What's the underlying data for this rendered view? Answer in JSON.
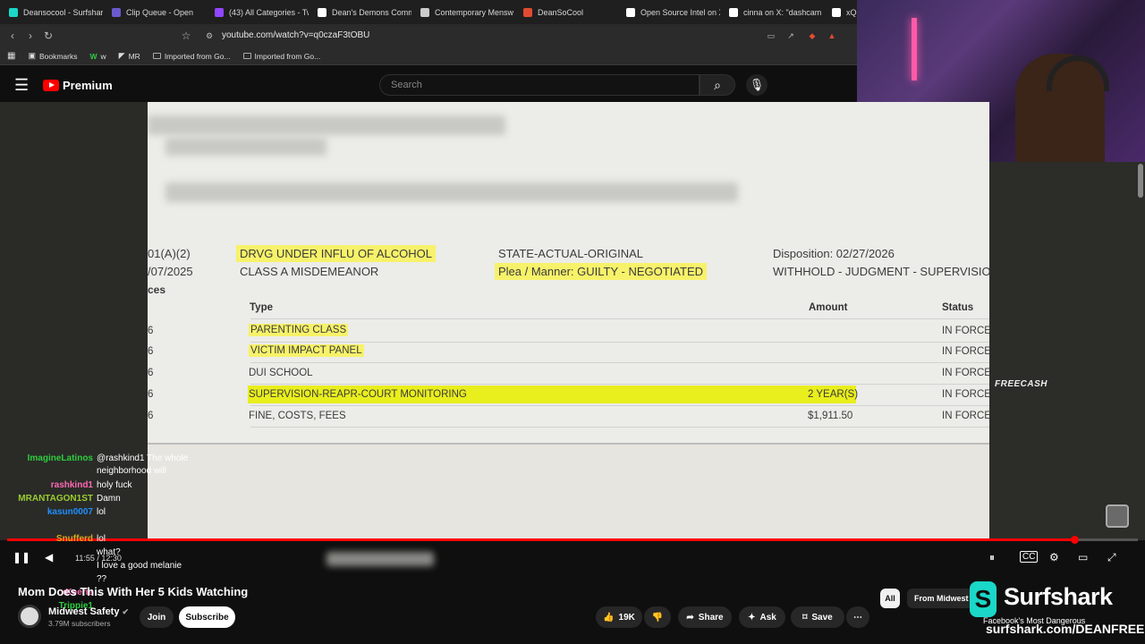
{
  "browser": {
    "tabs": [
      {
        "label": "Deansocool - Surfshark",
        "color": "#1ad7c7"
      },
      {
        "label": "Clip Queue - Open",
        "color": "#6a5acd"
      },
      {
        "label": "(43) All Categories - Tw",
        "color": "#9146ff"
      },
      {
        "label": "Dean's Demons Comm",
        "color": "#ffffff"
      },
      {
        "label": "Contemporary Mensw",
        "color": "#cccccc"
      },
      {
        "label": "DeanSoCool",
        "color": "#e14b32"
      },
      {
        "label": "Open Source Intel on X",
        "color": "#ffffff"
      },
      {
        "label": "cinna on X: \"dashcam",
        "color": "#ffffff"
      },
      {
        "label": "xQc D",
        "color": "#ffffff"
      }
    ],
    "url": "youtube.com/watch?v=q0czaF3tOBU",
    "bookmarks": [
      "Bookmarks",
      "w",
      "MR",
      "Imported from Go...",
      "Imported from Go..."
    ]
  },
  "youtube": {
    "logo_label": "Premium",
    "search_placeholder": "Search",
    "video_title": "Mom Does This With Her 5 Kids Watching",
    "channel_name": "Midwest Safety",
    "subscribers": "3.79M subscribers",
    "join_label": "Join",
    "subscribe_label": "Subscribe",
    "like_count": "19K",
    "share_label": "Share",
    "ask_label": "Ask",
    "save_label": "Save",
    "chip_all": "All",
    "chip_from": "From Midwest",
    "timecode": "11:55 / 12:30",
    "progress": 0.944
  },
  "document": {
    "statute_fragment": "01(A)(2)",
    "date_fragment": "/07/2025",
    "charge": "DRVG UNDER INFLU OF ALCOHOL",
    "class": "CLASS A MISDEMEANOR",
    "state_label": "STATE-ACTUAL-ORIGINAL",
    "plea": "Plea / Manner: GUILTY - NEGOTIATED",
    "disposition": "Disposition: 02/27/2026",
    "withhold": "WITHHOLD - JUDGMENT - SUPERVISION",
    "section_fragment": "ces",
    "col_type": "Type",
    "col_amount": "Amount",
    "col_status": "Status",
    "rows": [
      {
        "prefix": "6",
        "type": "PARENTING CLASS",
        "amount": "",
        "status": "IN FORCE"
      },
      {
        "prefix": "6",
        "type": "VICTIM IMPACT PANEL",
        "amount": "",
        "status": "IN FORCE"
      },
      {
        "prefix": "6",
        "type": "DUI SCHOOL",
        "amount": "",
        "status": "IN FORCE"
      },
      {
        "prefix": "6",
        "type": "SUPERVISION-REAPR-COURT MONITORING",
        "amount": "2 YEAR(S)",
        "status": "IN FORCE"
      },
      {
        "prefix": "6",
        "type": "FINE, COSTS, FEES",
        "amount": "$1,911.50",
        "status": "IN FORCE"
      }
    ]
  },
  "overlay": {
    "freecash": "FREECASH",
    "surfshark_name": "Surfshark",
    "surfshark_url": "surfshark.com/DEANFREE",
    "recommended": "Facebook's Most Dangerous"
  },
  "chat": [
    {
      "user": "ImagineLatinos",
      "text": "@rashkind1 The whole",
      "color": "#2ecc40"
    },
    {
      "user": "",
      "text": "neighborhood will",
      "color": "#ffffff"
    },
    {
      "user": "rashkind1",
      "text": "holy fuck",
      "color": "#ff69b4"
    },
    {
      "user": "MRANTAGON1ST",
      "text": "Damn",
      "color": "#9acd32"
    },
    {
      "user": "kasun0007",
      "text": "lol",
      "color": "#1e90ff"
    },
    {
      "user": "",
      "text": "",
      "color": "#ff3333"
    },
    {
      "user": "Snufferd",
      "text": "lol",
      "color": "#daa520"
    },
    {
      "user": "",
      "text": "what?",
      "color": "#8a2be2"
    },
    {
      "user": "",
      "text": "I love a good melanie",
      "color": "#1e90ff"
    },
    {
      "user": "",
      "text": "??",
      "color": "#1e90ff"
    },
    {
      "user": "xKeerie",
      "text": "...",
      "color": "#ff69b4"
    },
    {
      "user": "Trippie1",
      "text": "",
      "color": "#2ecc40"
    }
  ]
}
